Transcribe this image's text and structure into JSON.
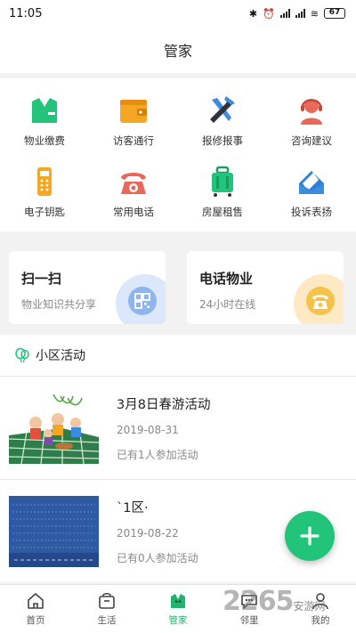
{
  "status_bar": {
    "time": "11:05",
    "battery": "67"
  },
  "header": {
    "title": "管家"
  },
  "services": [
    {
      "label": "物业缴费",
      "icon": "shirt-icon"
    },
    {
      "label": "访客通行",
      "icon": "wallet-icon"
    },
    {
      "label": "报修报事",
      "icon": "tools-icon"
    },
    {
      "label": "咨询建议",
      "icon": "support-agent-icon"
    },
    {
      "label": "电子钥匙",
      "icon": "key-fob-icon"
    },
    {
      "label": "常用电话",
      "icon": "telephone-icon"
    },
    {
      "label": "房屋租售",
      "icon": "luggage-icon"
    },
    {
      "label": "投诉表扬",
      "icon": "envelope-icon"
    }
  ],
  "quick": {
    "scan": {
      "title": "扫一扫",
      "subtitle": "物业知识共分享",
      "icon": "qr-code-icon"
    },
    "phone": {
      "title": "电话物业",
      "subtitle": "24小时在线",
      "icon": "telephone-icon"
    }
  },
  "section": {
    "title": "小区活动"
  },
  "activities": [
    {
      "title": "3月8日春游活动",
      "date": "2019-08-31",
      "count": "已有1人参加活动"
    },
    {
      "title": "`1区·",
      "date": "2019-08-22",
      "count": "已有0人参加活动"
    }
  ],
  "tabs": [
    {
      "label": "首页",
      "icon": "home-icon"
    },
    {
      "label": "生活",
      "icon": "shopping-bag-icon"
    },
    {
      "label": "管家",
      "icon": "butler-icon"
    },
    {
      "label": "邻里",
      "icon": "chat-icon"
    },
    {
      "label": "我的",
      "icon": "user-icon"
    }
  ],
  "watermark": {
    "brand": "2265",
    "suffix": "安游网"
  },
  "colors": {
    "accent": "#22c47a",
    "blue": "#3b8be0",
    "orange": "#f5a623",
    "red": "#e8685a"
  }
}
